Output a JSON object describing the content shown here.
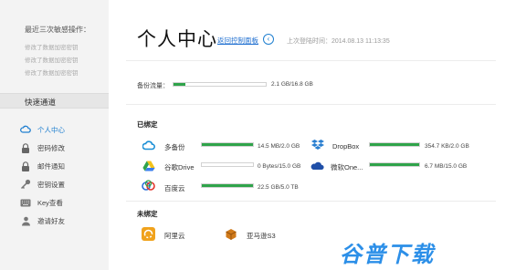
{
  "sidebar": {
    "heading": "最近三次敏感操作：",
    "recent": [
      "修改了数据加密密钥",
      "修改了数据加密密钥",
      "修改了数据加密密钥"
    ],
    "quick_title": "快速通道",
    "nav": [
      {
        "label": "个人中心",
        "icon": "cloud-icon"
      },
      {
        "label": "密码修改",
        "icon": "lock-icon"
      },
      {
        "label": "邮件通知",
        "icon": "lock-icon"
      },
      {
        "label": "密钥设置",
        "icon": "key-icon"
      },
      {
        "label": "Key查看",
        "icon": "keyboard-icon"
      },
      {
        "label": "邀请好友",
        "icon": "user-icon"
      }
    ]
  },
  "header": {
    "title": "个人中心",
    "back_link": "返回控制面板",
    "last_login": "上次登陆时间：2014.08.13 11:13:35"
  },
  "capacity": {
    "label": "备份流量：",
    "value": "2.1 GB/16.8 GB",
    "fraction": 0.125
  },
  "bound": {
    "title": "已绑定",
    "services": [
      {
        "name": "多备份",
        "value": "14.5 MB/2.0 GB",
        "fraction": 1.0,
        "icon": "duobeifen-icon",
        "color": "#1a8fd6"
      },
      {
        "name": "DropBox",
        "value": "354.7 KB/2.0 GB",
        "fraction": 1.0,
        "icon": "dropbox-icon",
        "color": "#2a7fd0"
      },
      {
        "name": "谷歌Drive",
        "value": "0 Bytes/15.0 GB",
        "fraction": 0.0,
        "icon": "google-drive-icon",
        "color": "#2fa34a"
      },
      {
        "name": "微软One...",
        "value": "6.7 MB/15.0 GB",
        "fraction": 1.0,
        "icon": "onedrive-icon",
        "color": "#1f4fa8"
      },
      {
        "name": "百度云",
        "value": "22.5 GB/5.0 TB",
        "fraction": 1.0,
        "icon": "baidu-cloud-icon",
        "color": "#2a6fd8"
      }
    ]
  },
  "unbound": {
    "title": "未绑定",
    "services": [
      {
        "name": "阿里云",
        "icon": "aliyun-icon",
        "color": "#f0a21c"
      },
      {
        "name": "亚马逊S3",
        "icon": "amazon-s3-icon",
        "color": "#d07a1a"
      }
    ]
  },
  "watermark": "谷普下载"
}
